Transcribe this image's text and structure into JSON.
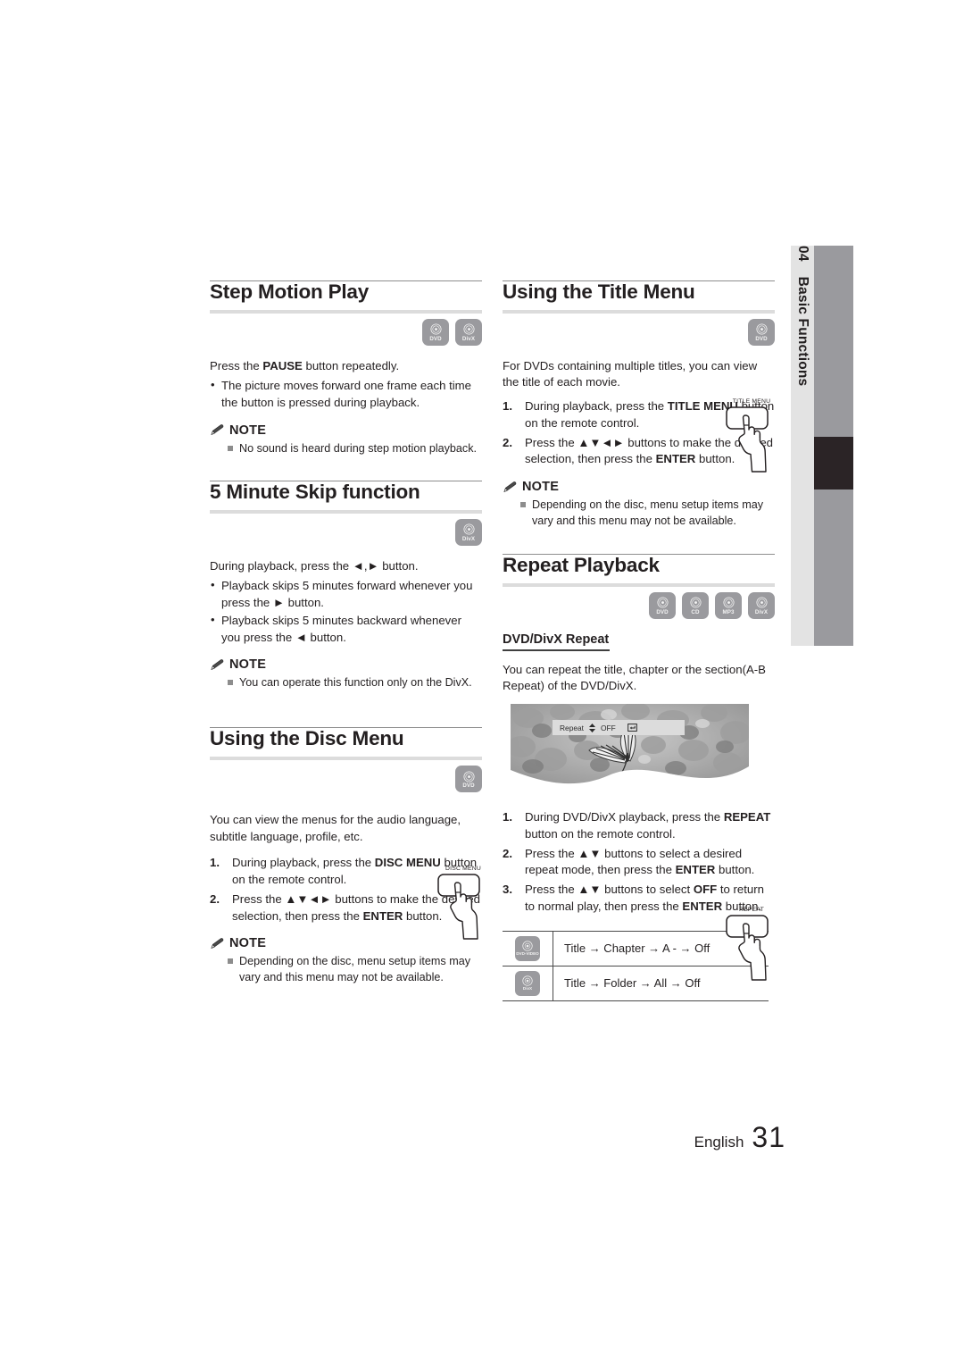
{
  "side_tab": {
    "number": "04",
    "label": "Basic Functions"
  },
  "footer": {
    "language": "English",
    "page": "31"
  },
  "note_label": "NOTE",
  "left_column": {
    "step_motion": {
      "heading": "Step Motion Play",
      "disc_types": [
        "DVD",
        "DivX"
      ],
      "intro_prefix": "Press the ",
      "intro_bold": "PAUSE",
      "intro_suffix": " button repeatedly.",
      "bullets": [
        "The picture moves forward one frame each time the button is pressed during playback."
      ],
      "notes": [
        "No sound is heard during step motion playback."
      ]
    },
    "skip": {
      "heading": "5 Minute Skip function",
      "disc_types": [
        "DivX"
      ],
      "intro": "During playback, press the ◄,► button.",
      "bullets": [
        "Playback skips 5 minutes forward whenever you press the ► button.",
        "Playback skips 5 minutes backward whenever you press the ◄ button."
      ],
      "notes": [
        "You can operate this function only on the DivX."
      ]
    },
    "disc_menu": {
      "heading": "Using the Disc Menu",
      "disc_types": [
        "DVD"
      ],
      "intro": "You can view the menus for the audio language, subtitle language, profile, etc.",
      "remote_key": "DISC MENU",
      "steps": [
        {
          "num": "1.",
          "parts": [
            {
              "t": "During playback, press the ",
              "b": false
            },
            {
              "t": "DISC MENU",
              "b": true
            },
            {
              "t": " button on the remote control.",
              "b": false
            }
          ]
        },
        {
          "num": "2.",
          "parts": [
            {
              "t": "Press the ▲▼◄► buttons to make the desired selection, then press the ",
              "b": false
            },
            {
              "t": "ENTER",
              "b": true
            },
            {
              "t": " button.",
              "b": false
            }
          ]
        }
      ],
      "notes": [
        "Depending on the disc, menu setup items may vary and this menu may not be available."
      ]
    }
  },
  "right_column": {
    "title_menu": {
      "heading": "Using the Title Menu",
      "disc_types": [
        "DVD"
      ],
      "intro": "For DVDs containing multiple titles, you can view the title of each movie.",
      "remote_key": "TITLE MENU",
      "steps": [
        {
          "num": "1.",
          "parts": [
            {
              "t": " During playback, press the ",
              "b": false
            },
            {
              "t": "TITLE MENU",
              "b": true
            },
            {
              "t": " button on the remote control.",
              "b": false
            }
          ]
        },
        {
          "num": "2.",
          "parts": [
            {
              "t": "Press the ▲▼◄► buttons to make the desired selection, then press the ",
              "b": false
            },
            {
              "t": "ENTER",
              "b": true
            },
            {
              "t": " button.",
              "b": false
            }
          ]
        }
      ],
      "notes": [
        "Depending on the disc, menu setup items may vary and this menu may not be available."
      ]
    },
    "repeat": {
      "heading": "Repeat Playback",
      "disc_types": [
        "DVD",
        "CD",
        "MP3",
        "DivX"
      ],
      "sub_heading": "DVD/DivX Repeat",
      "intro": "You can repeat the title, chapter or the section(A-B Repeat) of the DVD/DivX.",
      "osd": {
        "label": "Repeat",
        "value": "OFF",
        "arrows_icon": "updown-arrow-icon",
        "return_icon": "return-icon"
      },
      "remote_key": "REPEAT",
      "steps": [
        {
          "num": "1.",
          "parts": [
            {
              "t": "During DVD/DivX playback, press the ",
              "b": false
            },
            {
              "t": "REPEAT",
              "b": true
            },
            {
              "t": " button on the remote control.",
              "b": false
            }
          ]
        },
        {
          "num": "2.",
          "parts": [
            {
              "t": "Press the ▲▼ buttons to select a desired repeat mode, then press the ",
              "b": false
            },
            {
              "t": "ENTER",
              "b": true
            },
            {
              "t": " button.",
              "b": false
            }
          ]
        },
        {
          "num": "3.",
          "parts": [
            {
              "t": "Press the ▲▼ buttons to select ",
              "b": false
            },
            {
              "t": "OFF",
              "b": true
            },
            {
              "t": " to return to normal play, then press the ",
              "b": false
            },
            {
              "t": "ENTER",
              "b": true
            },
            {
              "t": " button.",
              "b": false
            }
          ]
        }
      ],
      "table": [
        {
          "disc": "DVD-VIDEO",
          "sequence": "Title → Chapter → A - → Off"
        },
        {
          "disc": "DivX",
          "sequence": "Title → Folder → All → Off"
        }
      ]
    }
  }
}
